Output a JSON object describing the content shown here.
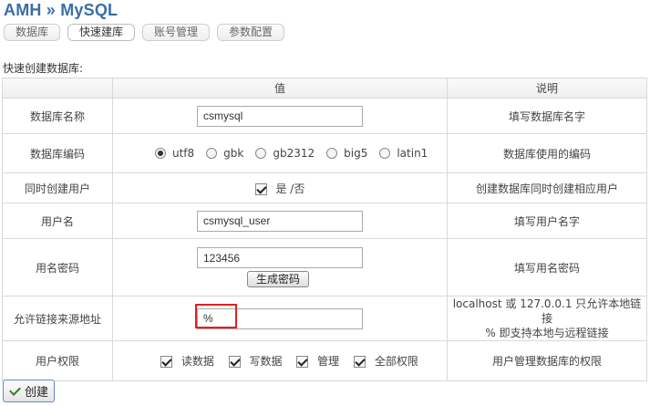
{
  "header": {
    "title": "AMH » MySQL"
  },
  "tabs": [
    {
      "label": "数据库"
    },
    {
      "label": "快速建库",
      "active": true
    },
    {
      "label": "账号管理"
    },
    {
      "label": "参数配置"
    }
  ],
  "section_label": "快速创建数据库:",
  "table": {
    "headers": {
      "label": "",
      "value": "值",
      "desc": "说明"
    },
    "db_name": {
      "label": "数据库名称",
      "value": "csmysql",
      "desc": "填写数据库名字"
    },
    "db_encoding": {
      "label": "数据库编码",
      "options": [
        {
          "label": "utf8",
          "selected": true
        },
        {
          "label": "gbk"
        },
        {
          "label": "gb2312"
        },
        {
          "label": "big5"
        },
        {
          "label": "latin1"
        }
      ],
      "desc": "数据库使用的编码"
    },
    "create_user": {
      "label": "同时创建用户",
      "checkbox_label": "是 /否",
      "checked": true,
      "desc": "创建数据库同时创建相应用户"
    },
    "username": {
      "label": "用户名",
      "value": "csmysql_user",
      "desc": "填写用户名字"
    },
    "password": {
      "label": "用名密码",
      "value": "123456",
      "generate_label": "生成密码",
      "desc": "填写用名密码"
    },
    "allowed_host": {
      "label": "允许链接来源地址",
      "value": "%",
      "desc_line1": "localhost 或  127.0.0.1 只允许本地链接",
      "desc_line2": "% 即支持本地与远程链接"
    },
    "permissions": {
      "label": "用户权限",
      "options": [
        {
          "label": "读数据",
          "checked": true
        },
        {
          "label": "写数据",
          "checked": true
        },
        {
          "label": "管理",
          "checked": true
        },
        {
          "label": "全部权限",
          "checked": true
        }
      ],
      "desc": "用户管理数据库的权限"
    }
  },
  "create_button": {
    "label": "创建"
  },
  "colors": {
    "title": "#3a6ea5",
    "highlight": "#e02020"
  }
}
